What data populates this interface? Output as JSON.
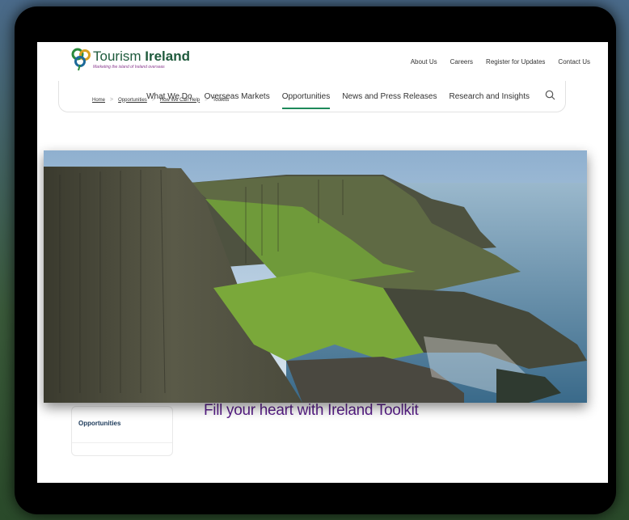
{
  "brand": {
    "name_light": "Tourism",
    "name_bold": "Ireland",
    "tagline": "Marketing the island of Ireland overseas",
    "color": "#1e5a3c"
  },
  "top_links": [
    "About Us",
    "Careers",
    "Register for Updates",
    "Contact Us"
  ],
  "nav": {
    "items": [
      "What We Do",
      "Overseas Markets",
      "Opportunities",
      "News and Press Releases",
      "Research and Insights"
    ],
    "active": "Opportunities",
    "accent": "#1e8a5a"
  },
  "breadcrumb": [
    "Home",
    "Opportunities",
    "How We Can Help",
    "Toolkits"
  ],
  "sidebar": {
    "label": "Opportunities"
  },
  "heading": {
    "text": "Fill your heart with Ireland Toolkit",
    "color": "#5a1f8a"
  },
  "icons": {
    "search": "search-icon",
    "logo": "shamrock-logo-icon"
  }
}
